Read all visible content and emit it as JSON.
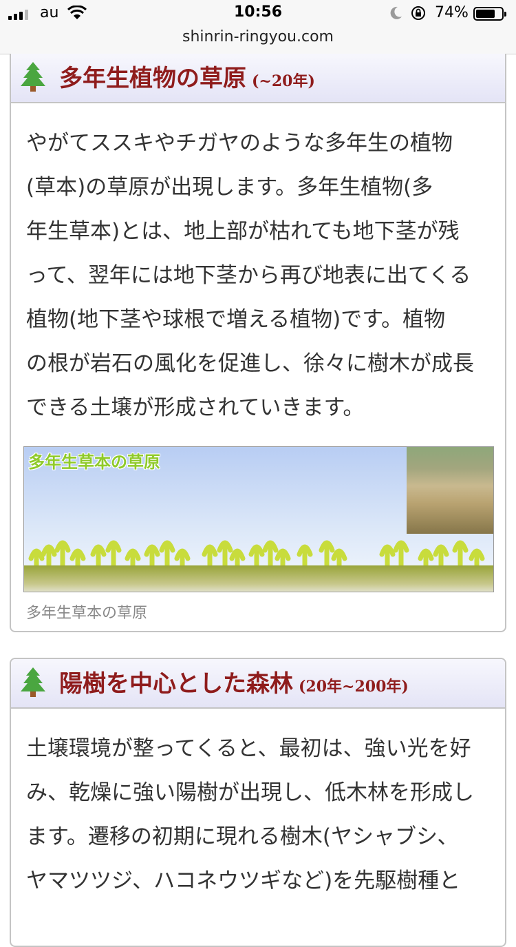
{
  "status_bar": {
    "carrier": "au",
    "time": "10:56",
    "battery": "74%",
    "battery_level": 0.74
  },
  "url": "shinrin-ringyou.com",
  "sections": [
    {
      "title": "多年生植物の草原",
      "period": "(~20年)",
      "icon": "tree-icon",
      "lines": [
        "やがてススキやチガヤのような多年生の植物",
        "(草本)の草原が出現します。多年生植物(多",
        "年生草本)とは、地上部が枯れても地下茎が残",
        "って、翌年には地下茎から再び地表に出てくる",
        "植物(地下茎や球根で増える植物)です。植物",
        "の根が岩石の風化を促進し、徐々に樹木が成長",
        "できる土壌が形成されていきます。"
      ],
      "figure_label": "多年生草本の草原",
      "caption": "多年生草本の草原"
    },
    {
      "title": "陽樹を中心とした森林",
      "period": "(20年~200年)",
      "icon": "tree-icon",
      "lines": [
        "土壌環境が整ってくると、最初は、強い光を好",
        "み、乾燥に強い陽樹が出現し、低木林を形成し",
        "ます。遷移の初期に現れる樹木(ヤシャブシ、",
        "ヤマツツジ、ハコネウツギなど)を先駆樹種と"
      ]
    }
  ],
  "colors": {
    "heading": "#8f1c1c",
    "header_bg": "#e4e4f6",
    "border": "#c4c4c4",
    "plant": "#c8dc3c"
  }
}
